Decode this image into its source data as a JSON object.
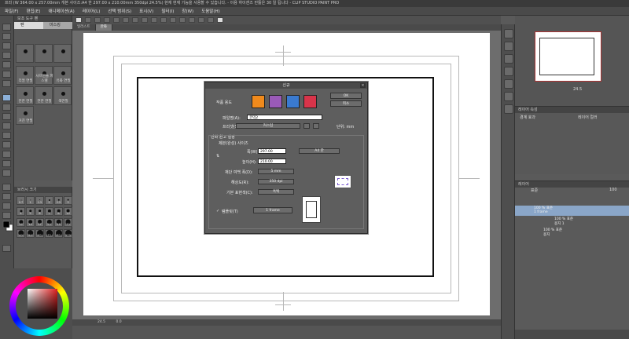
{
  "titlebar": {
    "text": "프라 (W 364.00 x 257.00mm 개본 사이즈:A4 한 297.00 x 210.00mm 350dpi 24.5%) 현재 현재 기능을 사용할 수 있습니다. - 이용 하이센즈 만듦은 30 일 됩니다 - CLIP STUDIO PAINT PRO"
  },
  "menubar": {
    "items": [
      "파일(F)",
      "편집(E)",
      "애니메이션(A)",
      "레이어(L)",
      "선택 범위(S)",
      "표시(V)",
      "필터(I)",
      "창(W)",
      "도움말(H)"
    ]
  },
  "subtool_panel": {
    "header": "보조 도구 펜",
    "tabs": [
      "펜",
      "마스킹"
    ],
    "brushes": [
      "",
      "",
      "",
      "리얼 연필",
      "사프펜슬 파스텔",
      "유화 연필",
      "진한 연필",
      "연한 연필",
      "색연필",
      "거친 연필"
    ]
  },
  "brushsize_panel": {
    "header": "브러시 크기",
    "sizes": [
      "0.7",
      "1",
      "1.5",
      "2",
      "2.5",
      "3",
      "4",
      "5",
      "6",
      "7",
      "8",
      "10",
      "12",
      "15",
      "17",
      "20",
      "25",
      "30",
      "40",
      "50",
      "60",
      "70",
      "80",
      "100"
    ]
  },
  "canvas": {
    "tabs": [
      "일러스트",
      "만화"
    ],
    "zoom": "24.5",
    "coords": "0.0"
  },
  "navigator": {
    "zoom": "24.5"
  },
  "layer_property": {
    "header": "레이어 속성",
    "effect": "경계 효과",
    "layer_color": "레이어 컬러"
  },
  "layer_panel": {
    "header": "레이어",
    "blend": "표준",
    "opacity": "100",
    "layers": [
      {
        "name": "100 % 표준",
        "sub": "1 frame",
        "selected": true
      },
      {
        "name": "100 % 표준",
        "sub": "용지 1",
        "selected": false
      },
      {
        "name": "100 % 표준",
        "sub": "용지",
        "selected": false
      }
    ]
  },
  "dialog": {
    "title": "신규",
    "ok": "OK",
    "cancel": "취소",
    "use_label": "작품 용도",
    "filename_label": "파일명(A):",
    "filename_value": "코믹2",
    "preset_label": "프리셋(S):",
    "preset_value": "커스텀",
    "unit_label": "단위: mm",
    "section_label": "만화 원고 설정",
    "size_label": "제본(완성) 사이즈",
    "width_label": "폭(W):",
    "width_value": "297.00",
    "height_label": "높이(H):",
    "height_value": "210.00",
    "paper_value": "A4 한",
    "bleed_label": "재단 여백 폭(D):",
    "bleed_value": "5 mm",
    "resolution_label": "해상도(R):",
    "resolution_value": "350 dpi",
    "color_label": "기본 표현색(C):",
    "color_value": "흑백",
    "template_label": "템플릿(T)",
    "template_value": "1 frame"
  },
  "colors": {
    "accent_orange": "#f08a1c",
    "accent_purple": "#9a5ab8",
    "accent_blue": "#3a7ad0",
    "accent_red": "#d8344a",
    "selected_layer": "#8aa6c8"
  }
}
